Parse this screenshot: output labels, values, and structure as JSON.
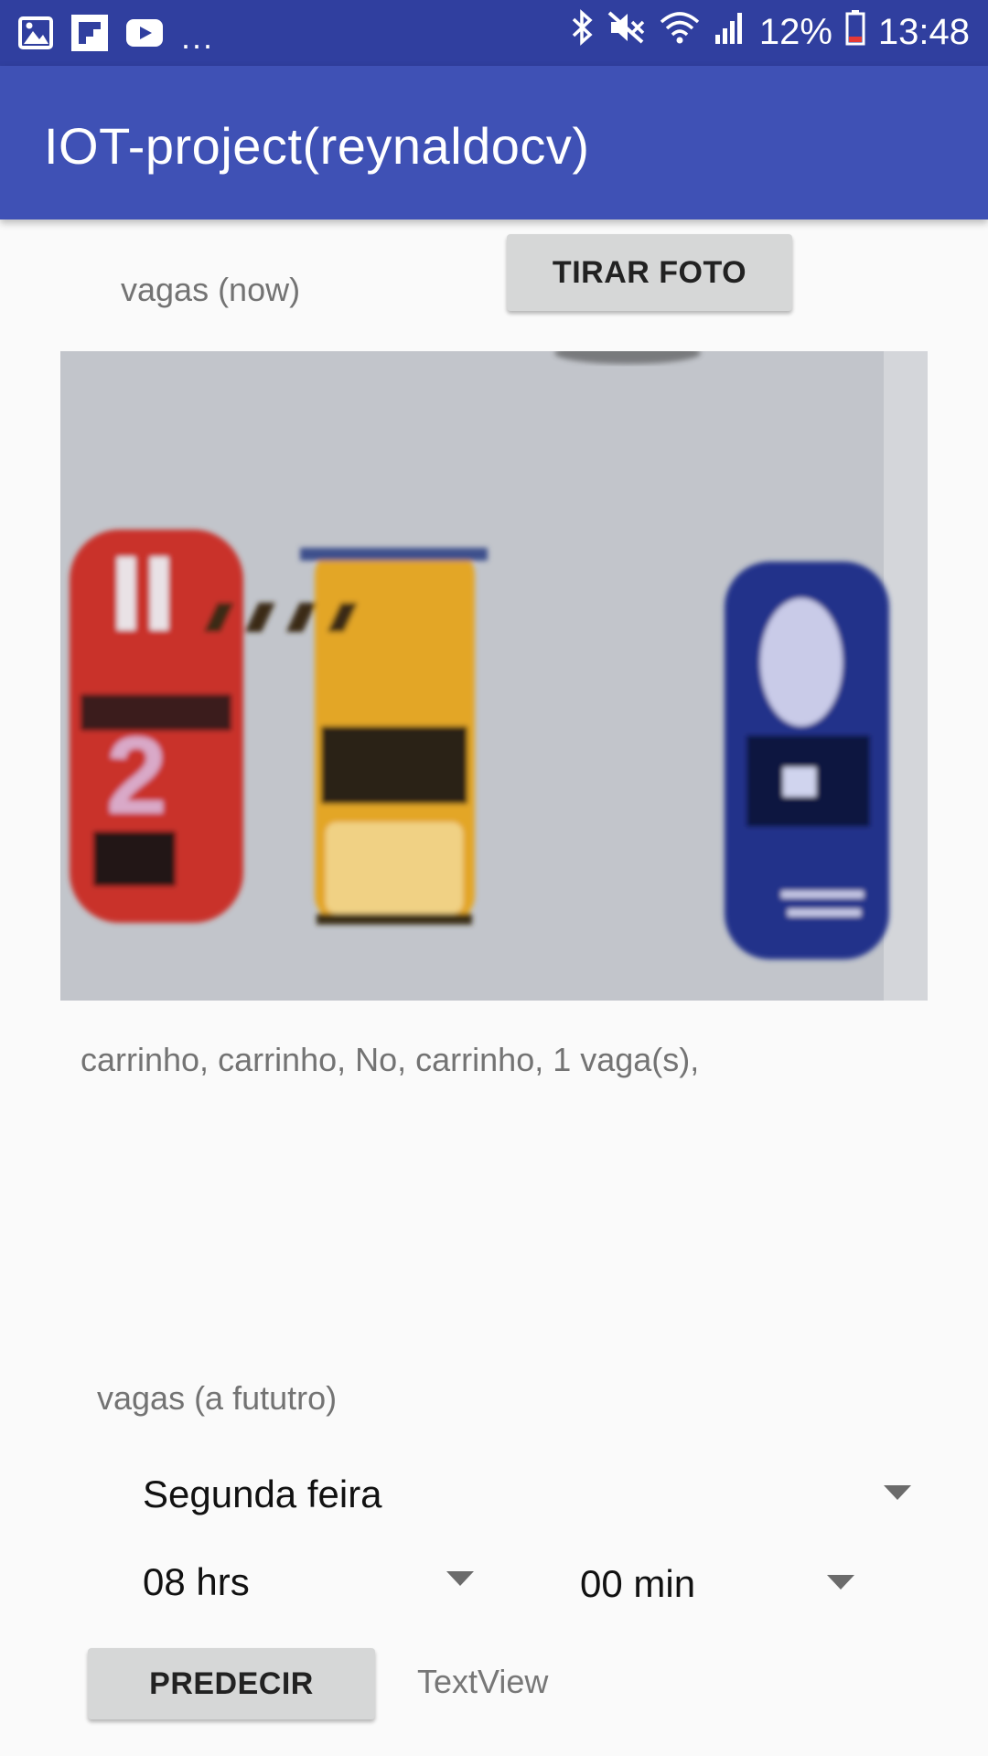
{
  "status_bar": {
    "left_icons": [
      "gallery-icon",
      "flipboard-icon",
      "youtube-icon"
    ],
    "more": "...",
    "right_icons": [
      "bluetooth-icon",
      "mute-icon",
      "wifi-icon",
      "signal-icon"
    ],
    "battery_percent": "12%",
    "time": "13:48"
  },
  "app_bar": {
    "title": "IOT-project(reynaldocv)"
  },
  "now_section": {
    "label": "vagas (now)",
    "photo_button": "TIRAR FOTO",
    "result_text": "carrinho, carrinho, No, carrinho, 1 vaga(s),"
  },
  "future_section": {
    "label": "vagas (a fututro)",
    "day_spinner": "Segunda feira",
    "hour_spinner": "08 hrs",
    "minute_spinner": "00 min",
    "predict_button": "PREDECIR",
    "result_textview": "TextView"
  },
  "colors": {
    "status_bar": "#303f9f",
    "app_bar": "#3f51b5",
    "background": "#fafafa",
    "button": "#d6d7d7"
  }
}
